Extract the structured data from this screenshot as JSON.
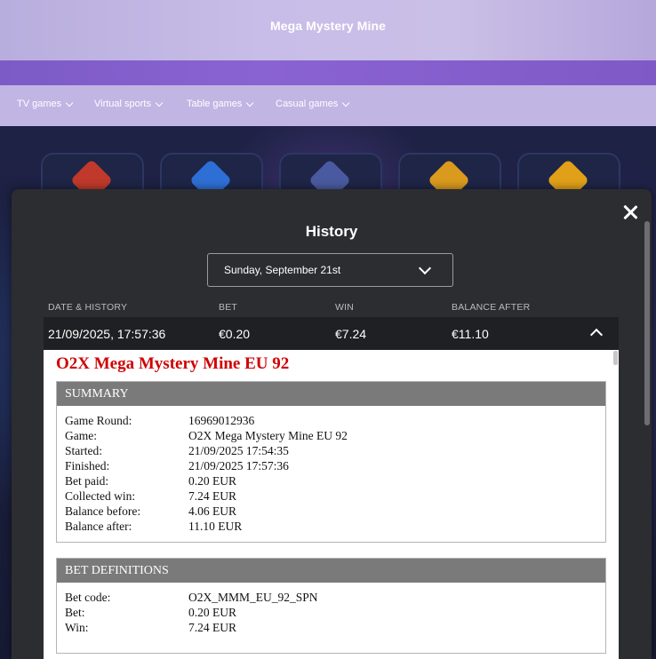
{
  "header": {
    "title": "Mega Mystery Mine"
  },
  "nav": [
    {
      "label": "TV games"
    },
    {
      "label": "Virtual sports"
    },
    {
      "label": "Table games"
    },
    {
      "label": "Casual games"
    }
  ],
  "history": {
    "title": "History",
    "date_select": {
      "value": "Sunday, September 21st"
    },
    "columns": {
      "date": "DATE & HISTORY",
      "bet": "BET",
      "win": "WIN",
      "balance": "BALANCE AFTER"
    },
    "row": {
      "date": "21/09/2025, 17:57:36",
      "bet": "€0.20",
      "win": "€7.24",
      "balance": "€11.10"
    },
    "detail": {
      "game_title": "O2X Mega Mystery Mine EU 92",
      "summary": {
        "heading": "SUMMARY",
        "rows": [
          {
            "k": "Game Round:",
            "v": "16969012936"
          },
          {
            "k": "Game:",
            "v": "O2X Mega Mystery Mine EU 92"
          },
          {
            "k": "Started:",
            "v": "21/09/2025 17:54:35"
          },
          {
            "k": "Finished:",
            "v": "21/09/2025 17:57:36"
          },
          {
            "k": "Bet paid:",
            "v": "0.20 EUR"
          },
          {
            "k": "Collected win:",
            "v": "7.24 EUR"
          },
          {
            "k": "Balance before:",
            "v": "4.06 EUR"
          },
          {
            "k": "Balance after:",
            "v": "11.10 EUR"
          }
        ]
      },
      "bet_definitions": {
        "heading": "BET DEFINITIONS",
        "rows": [
          {
            "k": "Bet code:",
            "v": "O2X_MMM_EU_92_SPN"
          },
          {
            "k": "Bet:",
            "v": "0.20 EUR"
          },
          {
            "k": "Win:",
            "v": "7.24 EUR"
          }
        ]
      }
    }
  },
  "colors": {
    "accent_red": "#d00000",
    "modal_bg": "#2c2d31",
    "nav_bg": "#c1b5e3"
  }
}
